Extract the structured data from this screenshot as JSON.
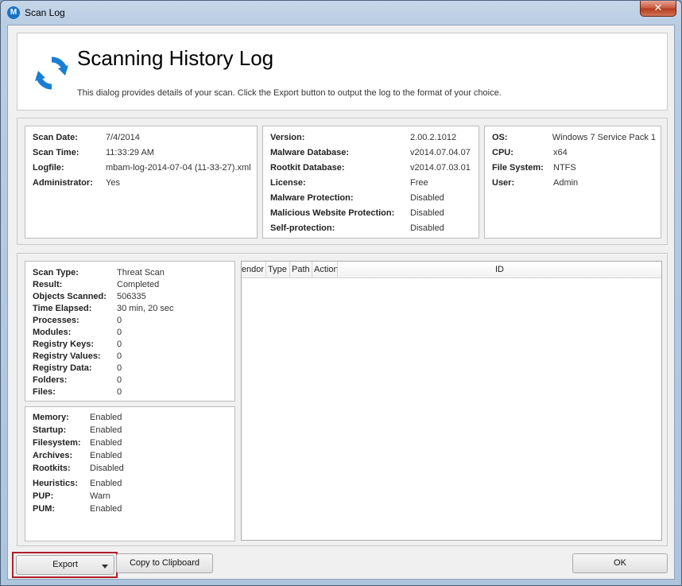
{
  "window": {
    "title": "Scan Log",
    "close_symbol": "✕",
    "app_icon": "malwarebytes-icon",
    "app_icon_glyph": "M"
  },
  "header": {
    "title": "Scanning History Log",
    "description": "This dialog provides details of your scan.  Click the Export button to output the log to the format of your choice.",
    "icon": "refresh-icon",
    "accent_color": "#1a7fd4"
  },
  "scan_info": [
    {
      "label": "Scan Date:",
      "value": "7/4/2014"
    },
    {
      "label": "Scan Time:",
      "value": "11:33:29 AM"
    },
    {
      "label": "Logfile:",
      "value": "mbam-log-2014-07-04 (11-33-27).xml"
    },
    {
      "label": "Administrator:",
      "value": "Yes"
    }
  ],
  "version_info": [
    {
      "label": "Version:",
      "value": "2.00.2.1012"
    },
    {
      "label": "Malware Database:",
      "value": "v2014.07.04.07"
    },
    {
      "label": "Rootkit Database:",
      "value": "v2014.07.03.01"
    },
    {
      "label": "License:",
      "value": "Free"
    },
    {
      "label": "Malware Protection:",
      "value": "Disabled"
    },
    {
      "label": "Malicious Website Protection:",
      "value": "Disabled"
    },
    {
      "label": "Self-protection:",
      "value": "Disabled"
    }
  ],
  "system_info": [
    {
      "label": "OS:",
      "value": "Windows 7 Service Pack 1"
    },
    {
      "label": "CPU:",
      "value": "x64"
    },
    {
      "label": "File System:",
      "value": "NTFS"
    },
    {
      "label": "User:",
      "value": "Admin"
    }
  ],
  "scan_stats": [
    {
      "label": "Scan Type:",
      "value": "Threat Scan"
    },
    {
      "label": "Result:",
      "value": "Completed"
    },
    {
      "label": "Objects Scanned:",
      "value": "506335"
    },
    {
      "label": "Time Elapsed:",
      "value": "30 min, 20 sec"
    },
    {
      "label": "Processes:",
      "value": "0"
    },
    {
      "label": "Modules:",
      "value": "0"
    },
    {
      "label": "Registry Keys:",
      "value": "0"
    },
    {
      "label": "Registry Values:",
      "value": "0"
    },
    {
      "label": "Registry Data:",
      "value": "0"
    },
    {
      "label": "Folders:",
      "value": "0"
    },
    {
      "label": "Files:",
      "value": "0"
    }
  ],
  "scan_settings": [
    {
      "label": "Memory:",
      "value": "Enabled"
    },
    {
      "label": "Startup:",
      "value": "Enabled"
    },
    {
      "label": "Filesystem:",
      "value": "Enabled"
    },
    {
      "label": "Archives:",
      "value": "Enabled"
    },
    {
      "label": "Rootkits:",
      "value": "Disabled"
    },
    {
      "label": "Heuristics:",
      "value": "Enabled"
    },
    {
      "label": "PUP:",
      "value": "Warn"
    },
    {
      "label": "PUM:",
      "value": "Enabled"
    }
  ],
  "results_table": {
    "columns": [
      "Vendor",
      "Type",
      "Path",
      "Action",
      "ID"
    ],
    "rows": []
  },
  "buttons": {
    "export": "Export",
    "copy": "Copy to Clipboard",
    "ok": "OK"
  },
  "colors": {
    "highlight_border": "#b01e2a"
  }
}
